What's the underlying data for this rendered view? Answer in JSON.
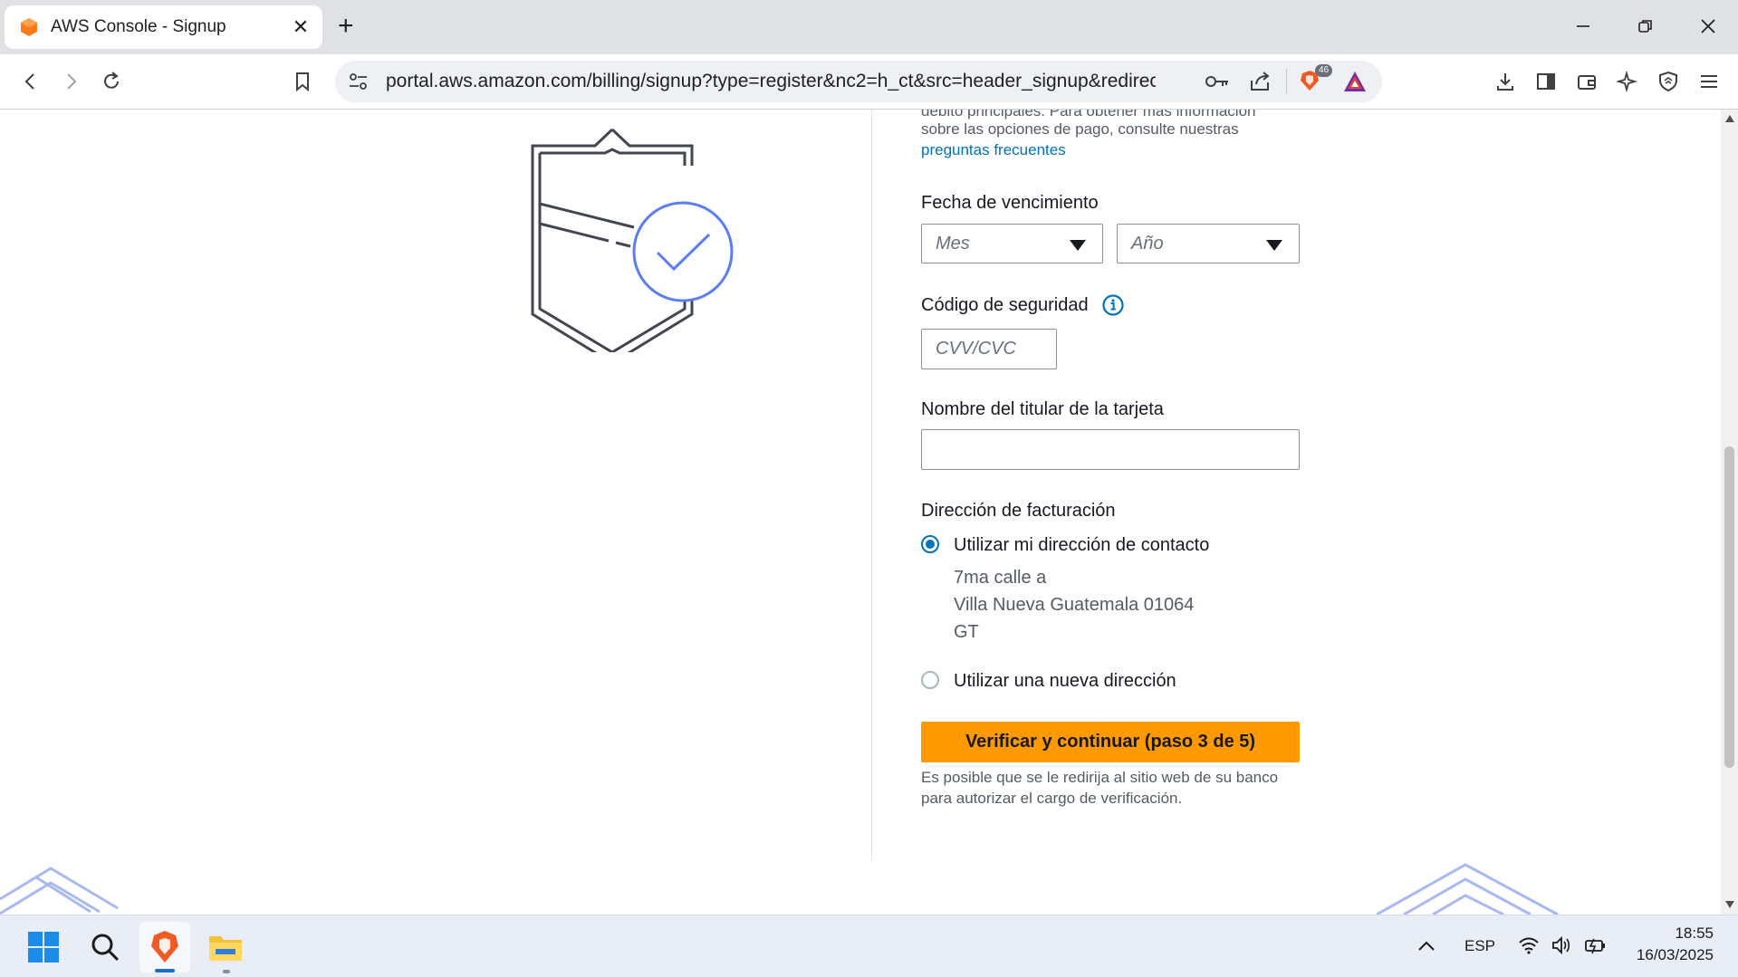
{
  "browser": {
    "tab_title": "AWS Console - Signup",
    "url": "portal.aws.amazon.com/billing/signup?type=register&nc2=h_ct&src=header_signup&redirec...",
    "shield_count": "46"
  },
  "form": {
    "top_text_partial": "débito principales. Para obtener más información",
    "payment_text": "sobre las opciones de pago, consulte nuestras",
    "faq_link": "preguntas frecuentes",
    "expiry_label": "Fecha de vencimiento",
    "month_placeholder": "Mes",
    "year_placeholder": "Año",
    "security_label": "Código de seguridad",
    "cvv_placeholder": "CVV/CVC",
    "cardholder_label": "Nombre del titular de la tarjeta",
    "cardholder_value": "",
    "billing_label": "Dirección de facturación",
    "option_contact": "Utilizar mi dirección de contacto",
    "address_line1": "7ma calle a",
    "address_line2": "Villa Nueva Guatemala 01064",
    "address_line3": "GT",
    "option_new": "Utilizar una nueva dirección",
    "submit": "Verificar y continuar (paso 3 de 5)",
    "note_line1": "Es posible que se le redirija al sitio web de su banco",
    "note_line2": "para autorizar el cargo de verificación."
  },
  "taskbar": {
    "language": "ESP",
    "time": "18:55",
    "date": "16/03/2025"
  },
  "colors": {
    "accent": "#0073bb",
    "cta": "#ff9900",
    "illustration_blue": "#5a7df2"
  }
}
